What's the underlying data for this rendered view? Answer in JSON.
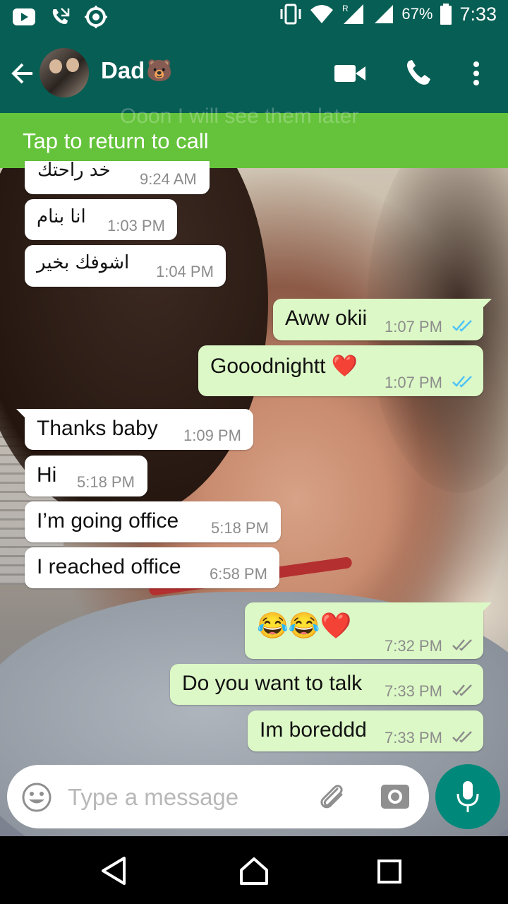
{
  "status_bar": {
    "battery": "67%",
    "time": "7:33",
    "icons": [
      "youtube-icon",
      "missed-call-icon",
      "settings-icon",
      "vibrate-icon",
      "wifi-icon",
      "signal-icon",
      "signal-icon",
      "battery-icon"
    ]
  },
  "header": {
    "contact_name": "Dad",
    "contact_emoji": "🐻",
    "icons": [
      "back-arrow-icon",
      "video-call-icon",
      "phone-icon",
      "more-vert-icon"
    ]
  },
  "banner": {
    "text": "Tap to return to call",
    "background_text": "Ooon I will see them later"
  },
  "messages": [
    {
      "direction": "in",
      "text": "خد راحتك",
      "time": "9:24 AM"
    },
    {
      "direction": "in",
      "text": "انا بنام",
      "time": "1:03 PM"
    },
    {
      "direction": "in",
      "text": "اشوفك بخير",
      "time": "1:04 PM"
    },
    {
      "direction": "out",
      "text": "Aww okii",
      "time": "1:07 PM",
      "status": "read"
    },
    {
      "direction": "out",
      "text": "Gooodnightt ❤️",
      "time": "1:07 PM",
      "status": "read"
    },
    {
      "direction": "in",
      "text": "Thanks baby",
      "time": "1:09 PM"
    },
    {
      "direction": "in",
      "text": "Hi",
      "time": "5:18 PM"
    },
    {
      "direction": "in",
      "text": "I’m going office",
      "time": "5:18 PM"
    },
    {
      "direction": "in",
      "text": "I reached office",
      "time": "6:58 PM"
    },
    {
      "direction": "out",
      "text": "😂😂❤️",
      "time": "7:32 PM",
      "status": "delivered"
    },
    {
      "direction": "out",
      "text": "Do you want to talk",
      "time": "7:33 PM",
      "status": "delivered"
    },
    {
      "direction": "out",
      "text": "Im boreddd",
      "time": "7:33 PM",
      "status": "delivered"
    }
  ],
  "composer": {
    "placeholder": "Type a message",
    "icons": [
      "emoji-icon",
      "attach-icon",
      "camera-icon",
      "mic-icon"
    ]
  },
  "nav": {
    "icons": [
      "back-nav-icon",
      "home-nav-icon",
      "recents-nav-icon"
    ]
  },
  "colors": {
    "header": "#075e54",
    "banner": "#64c33a",
    "outgoing_bubble": "#dcf8c6",
    "incoming_bubble": "#ffffff",
    "read_ticks": "#4fc3f7",
    "mic_button": "#00897b"
  }
}
